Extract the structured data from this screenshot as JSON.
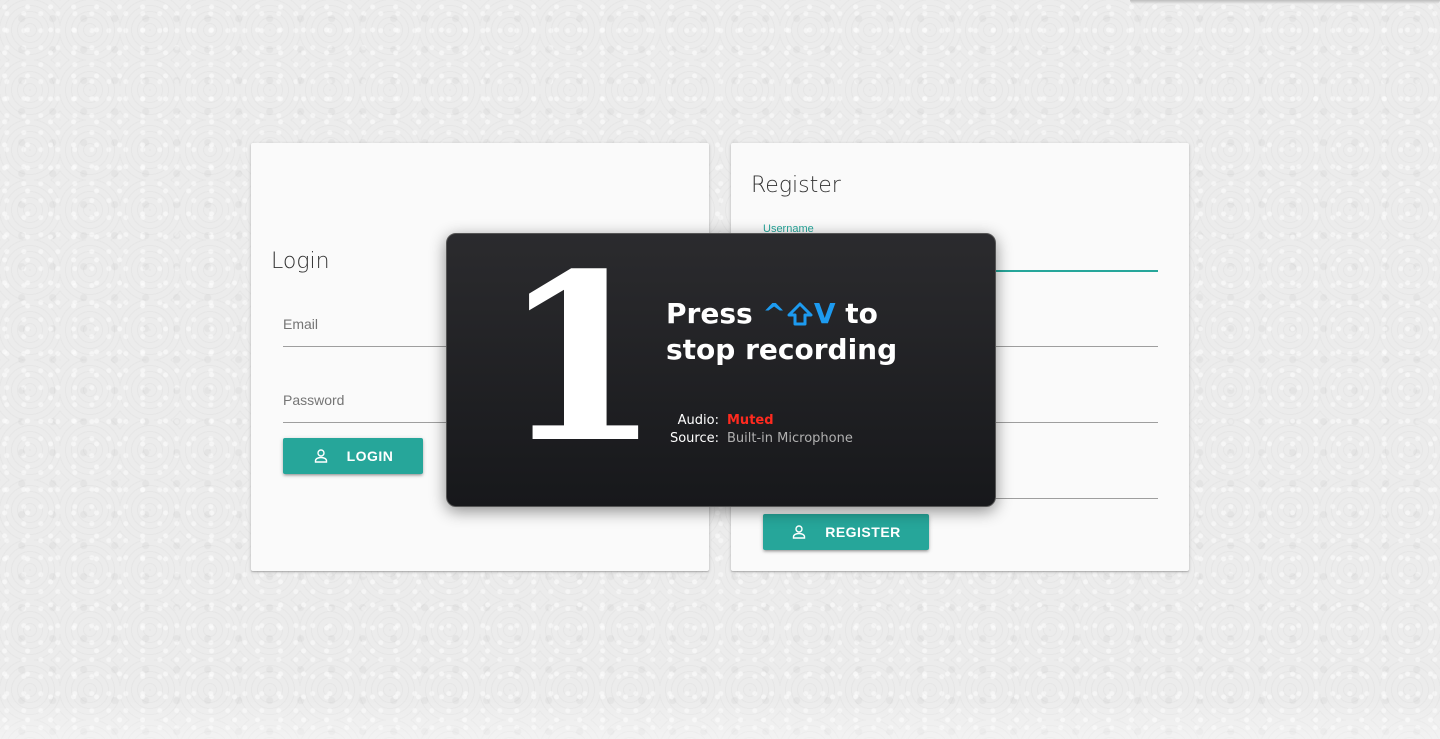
{
  "login": {
    "title": "Login",
    "email_label": "Email",
    "password_label": "Password",
    "button_label": "LOGIN"
  },
  "register": {
    "title": "Register",
    "username_label": "Username",
    "button_label": "REGISTER"
  },
  "recording": {
    "countdown": "1",
    "press_text": "Press",
    "shortcut_key_ctrl": "^",
    "shortcut_key_shift_icon": "shift-arrow",
    "shortcut_key_letter": "V",
    "to_text": "to",
    "stop_text": "stop recording",
    "audio_label": "Audio:",
    "audio_value": "Muted",
    "source_label": "Source:",
    "source_value": "Built-in Microphone"
  },
  "colors": {
    "accent": "#26a69a",
    "shortcut": "#1d9bf0",
    "muted": "#ff2a1f",
    "overlay_bg": "#1f2023"
  }
}
